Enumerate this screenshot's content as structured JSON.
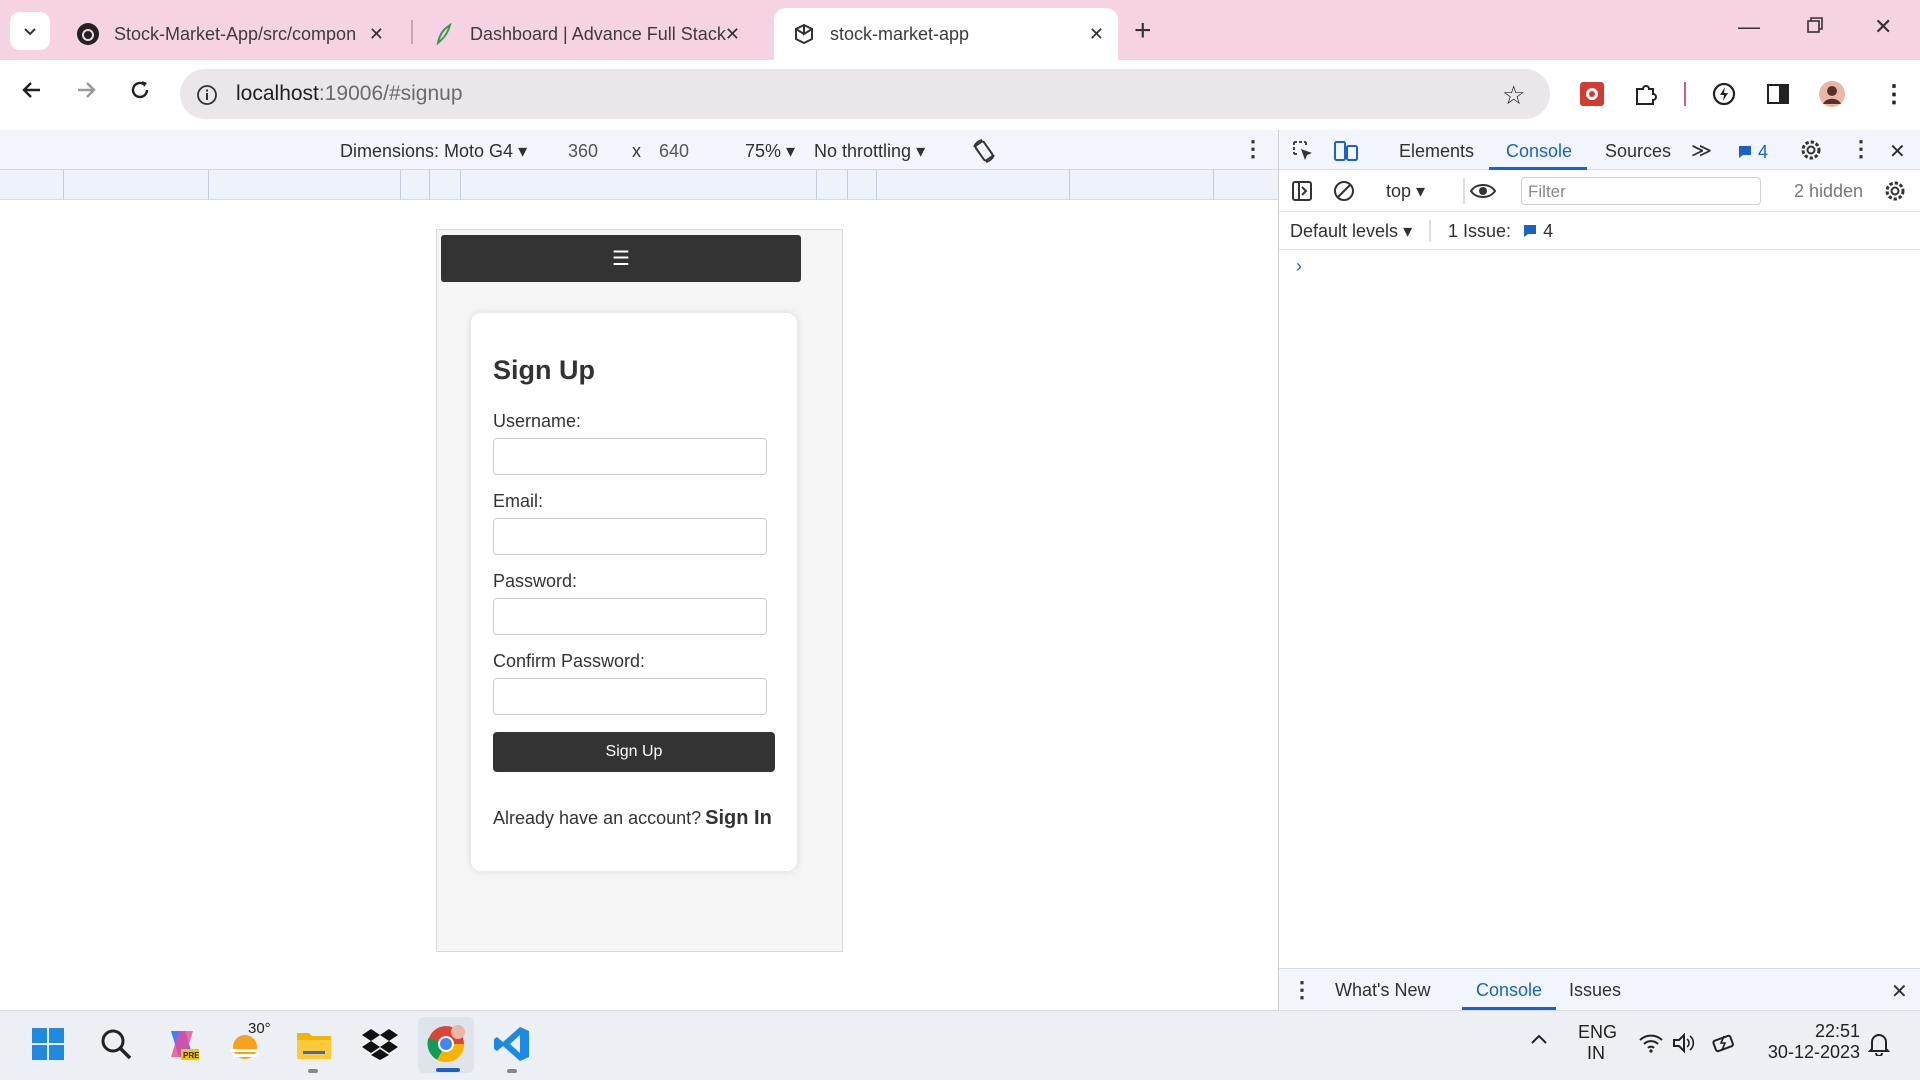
{
  "browser": {
    "tabs": [
      {
        "title": "Stock-Market-App/src/compon"
      },
      {
        "title": "Dashboard | Advance Full Stack"
      },
      {
        "title": "stock-market-app"
      }
    ],
    "url_host": "localhost",
    "url_rest": ":19006/#signup"
  },
  "device_toolbar": {
    "dimensions": "Dimensions: Moto G4",
    "width": "360",
    "x": "x",
    "height": "640",
    "zoom": "75%",
    "throttling": "No throttling"
  },
  "app": {
    "menu_icon": "☰",
    "heading": "Sign Up",
    "fields": [
      {
        "label": "Username:"
      },
      {
        "label": "Email:"
      },
      {
        "label": "Password:"
      },
      {
        "label": "Confirm Password:"
      }
    ],
    "submit_label": "Sign Up",
    "already_text": "Already have an account?",
    "signin_link": "Sign In"
  },
  "devtools": {
    "tabs": [
      "Elements",
      "Console",
      "Sources"
    ],
    "issues_badge": "4",
    "context": "top",
    "filter_placeholder": "Filter",
    "hidden_count": "2 hidden",
    "levels": "Default levels",
    "issues_label": "1 Issue:",
    "issues_count": "4",
    "drawer_tabs": [
      "What's New",
      "Console",
      "Issues"
    ]
  },
  "taskbar": {
    "weather_temp": "30°",
    "lang_top": "ENG",
    "lang_bottom": "IN",
    "time": "22:51",
    "date": "30-12-2023"
  },
  "colors": {
    "tabstrip": "#f6d3e2",
    "accent": "#1a62c9",
    "app_dark": "#333333"
  }
}
